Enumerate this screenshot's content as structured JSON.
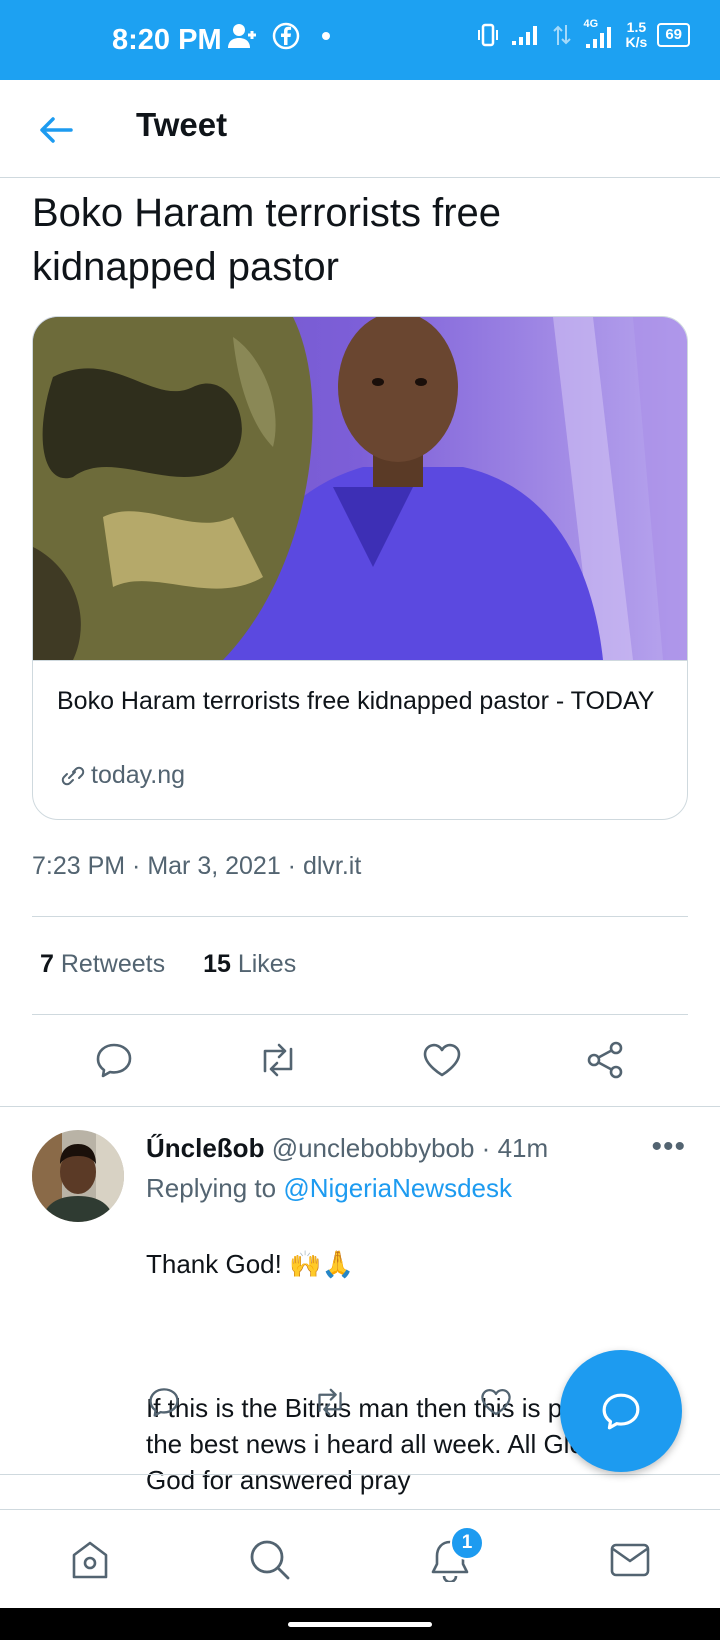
{
  "status_bar": {
    "time": "8:20 PM",
    "network": "4G",
    "speed_value": "1.5",
    "speed_unit": "K/s",
    "battery": "69",
    "icons": [
      "contact-icon",
      "facebook-icon",
      "dot-icon",
      "vibrate-icon",
      "signal-icon",
      "data-icon",
      "signal-4g-icon"
    ]
  },
  "header": {
    "title": "Tweet",
    "back_icon": "arrow-left-icon"
  },
  "tweet": {
    "text": "Boko Haram terrorists free kidnapped pastor",
    "card": {
      "title": "Boko Haram terrorists free kidnapped pastor - TODAY",
      "domain": "today.ng",
      "link_icon": "link-icon"
    },
    "timestamp": "7:23 PM · Mar 3, 2021 · dlvr.it",
    "retweets_count": "7",
    "retweets_label": "Retweets",
    "likes_count": "15",
    "likes_label": "Likes",
    "actions": [
      "reply-icon",
      "retweet-icon",
      "like-icon",
      "share-icon"
    ]
  },
  "reply": {
    "name": "ŰncleßobUnclebob",
    "display_name": "Űncleßob",
    "handle_time": "@unclebobbybob · 41m",
    "replying_prefix": "Replying to",
    "replying_to": "@NigeriaNewsdesk",
    "body_line1": "Thank God! 🙌🙏",
    "body_rest": "If this is the Bitrus man then this is probably the best news i heard all week. All Glory to God for answered pray",
    "more_label": "•••"
  },
  "fab": {
    "icon": "compose-reply-icon"
  },
  "bottom_nav": {
    "items": [
      "home-icon",
      "search-icon",
      "notifications-icon",
      "messages-icon"
    ],
    "notification_badge": "1"
  },
  "colors": {
    "accent": "#1d9bf0",
    "status_bar": "#1da1f2",
    "secondary_text": "#536471",
    "border": "#cfd9de"
  }
}
